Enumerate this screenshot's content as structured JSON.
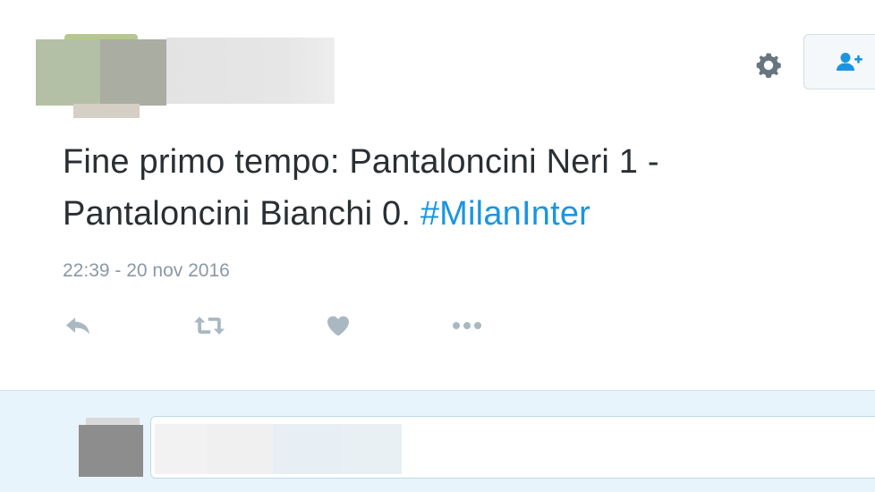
{
  "tweet": {
    "text_line_1": "Fine primo tempo: Pantaloncini Neri 1 -",
    "text_line_2": "Pantaloncini Bianchi 0.",
    "hashtag": "#MilanInter",
    "timestamp": "22:39 - 20 nov 2016"
  },
  "header": {
    "gear_icon": "gear-icon",
    "follow_icon": "add-user-icon"
  },
  "actions": [
    {
      "name": "reply",
      "icon": "reply-icon"
    },
    {
      "name": "retweet",
      "icon": "retweet-icon"
    },
    {
      "name": "like",
      "icon": "heart-icon"
    },
    {
      "name": "more",
      "icon": "more-icon"
    }
  ],
  "colors": {
    "text": "#292f33",
    "muted": "#8899a6",
    "accent": "#1b95e0",
    "reply_background": "#e8f4fb"
  }
}
